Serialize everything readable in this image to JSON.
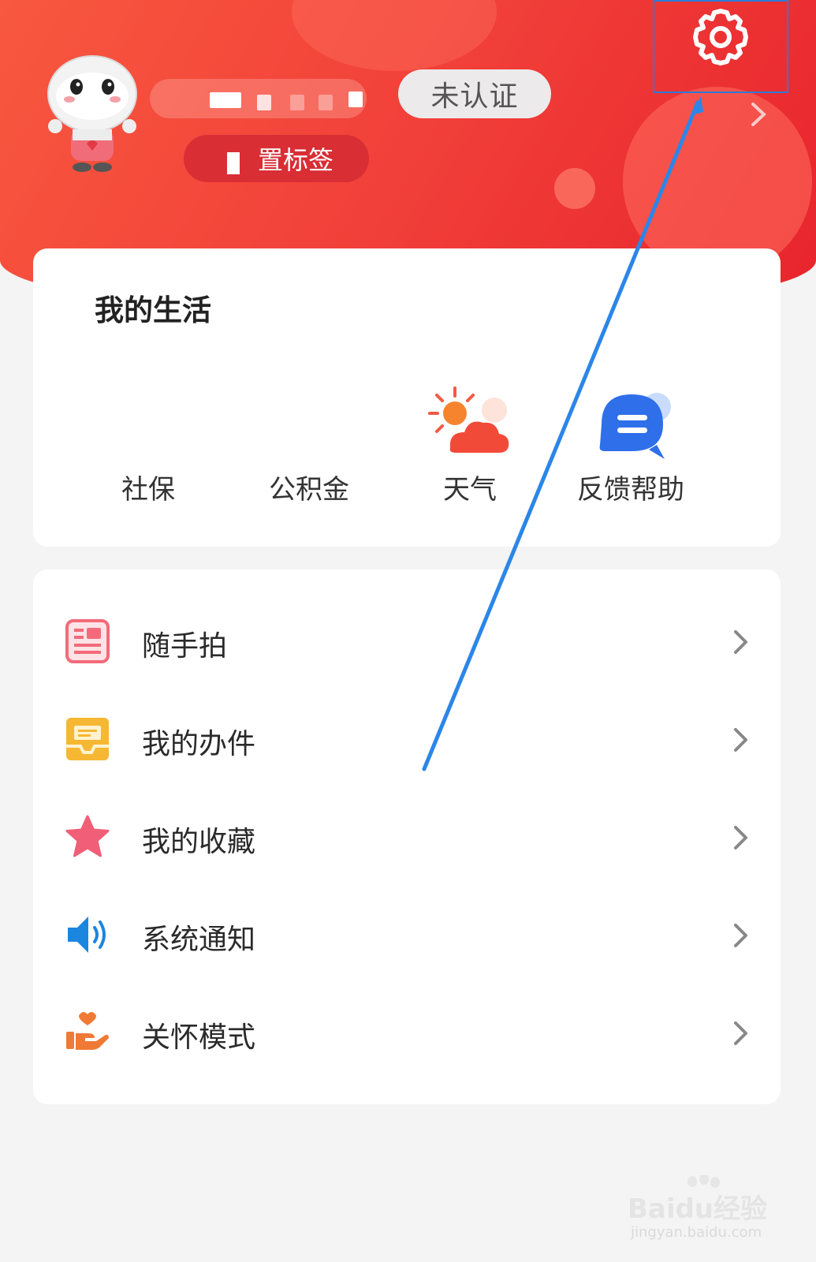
{
  "header": {
    "badge_label": "未认证",
    "tag_label": "置标签"
  },
  "life": {
    "title": "我的生活",
    "items": [
      {
        "label": "社保",
        "icon": "social-security-icon"
      },
      {
        "label": "公积金",
        "icon": "housing-fund-icon"
      },
      {
        "label": "天气",
        "icon": "weather-icon"
      },
      {
        "label": "反馈帮助",
        "icon": "feedback-chat-icon"
      }
    ]
  },
  "menu": {
    "items": [
      {
        "label": "随手拍",
        "icon": "snapshot-report-icon",
        "color": "#f36b7a"
      },
      {
        "label": "我的办件",
        "icon": "inbox-tray-icon",
        "color": "#f6b733"
      },
      {
        "label": "我的收藏",
        "icon": "star-icon",
        "color": "#f05f77"
      },
      {
        "label": "系统通知",
        "icon": "speaker-icon",
        "color": "#1b86e0"
      },
      {
        "label": "关怀模式",
        "icon": "care-hand-heart-icon",
        "color": "#f07a35"
      }
    ]
  },
  "watermark": {
    "brand": "Baidu经验",
    "url": "jingyan.baidu.com"
  },
  "colors": {
    "header_red": "#f2423a",
    "annotation_blue": "#2b7bd8"
  }
}
